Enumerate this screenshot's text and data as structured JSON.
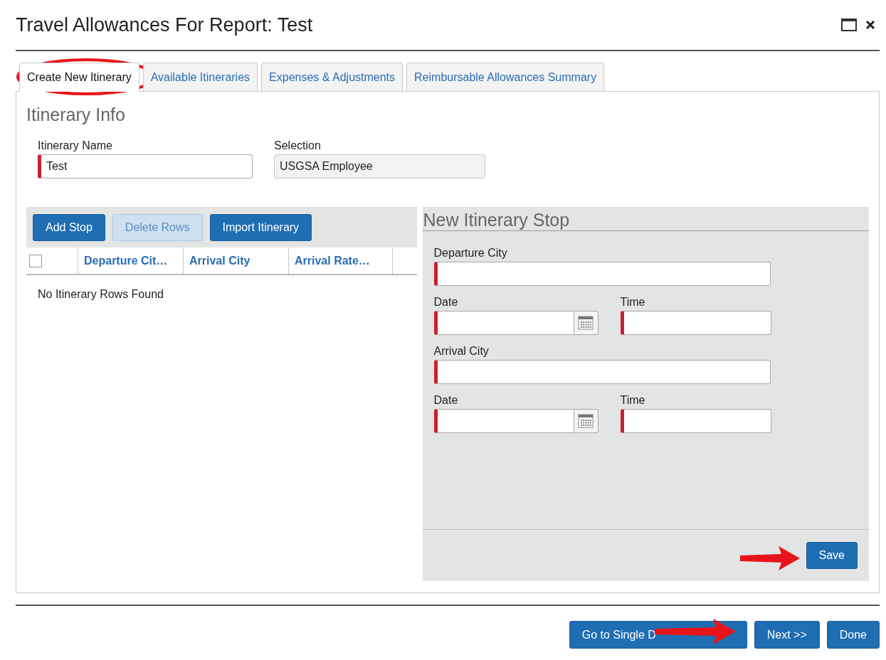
{
  "window": {
    "title": "Travel Allowances For Report: Test"
  },
  "tabs": [
    {
      "label": "Create New Itinerary",
      "selected": true
    },
    {
      "label": "Available Itineraries",
      "selected": false
    },
    {
      "label": "Expenses & Adjustments",
      "selected": false
    },
    {
      "label": "Reimbursable Allowances Summary",
      "selected": false
    }
  ],
  "itinerary_info": {
    "title": "Itinerary Info",
    "fields": [
      {
        "label": "Itinerary Name",
        "value": "Test",
        "required": true,
        "disabled": false
      },
      {
        "label": "Selection",
        "value": "USGSA Employee",
        "required": false,
        "disabled": true
      }
    ]
  },
  "itinerary_grid": {
    "buttons": [
      {
        "label": "Add Stop",
        "disabled": false
      },
      {
        "label": "Delete Rows",
        "disabled": true
      },
      {
        "label": "Import Itinerary",
        "disabled": false
      }
    ],
    "select_all": {
      "checked": false
    },
    "columns": [
      "Departure Cit…",
      "Arrival City",
      "Arrival Rate…"
    ],
    "empty_message": "No Itinerary Rows Found"
  },
  "stop_form": {
    "title": "New Itinerary Stop",
    "rows": [
      {
        "fields": [
          {
            "kind": "text",
            "label": "Departure City",
            "required": true
          }
        ]
      },
      {
        "fields": [
          {
            "kind": "date",
            "label": "Date",
            "required": true
          },
          {
            "kind": "time",
            "label": "Time",
            "required": true
          }
        ]
      },
      {
        "fields": [
          {
            "kind": "text",
            "label": "Arrival City",
            "required": true
          }
        ]
      },
      {
        "fields": [
          {
            "kind": "date",
            "label": "Date",
            "required": true
          },
          {
            "kind": "time",
            "label": "Time",
            "required": true
          }
        ]
      }
    ],
    "save_button": "Save"
  },
  "footer_buttons": [
    "Go to Single D",
    "Next >>",
    "Done"
  ]
}
